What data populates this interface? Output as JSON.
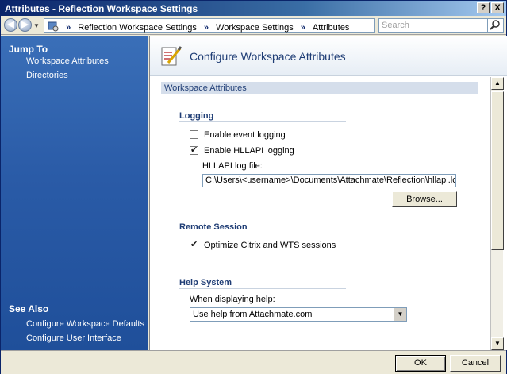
{
  "window": {
    "title": "Attributes - Reflection Workspace Settings",
    "help_button": "?",
    "close_button": "X"
  },
  "addressbar": {
    "crumbs": [
      "Reflection Workspace Settings",
      "Workspace Settings",
      "Attributes"
    ],
    "search_placeholder": "Search"
  },
  "leftpane": {
    "jump_to_header": "Jump To",
    "jump_links": [
      "Workspace Attributes",
      "Directories"
    ],
    "see_also_header": "See Also",
    "see_also_links": [
      "Configure Workspace Defaults",
      "Configure User Interface"
    ]
  },
  "main": {
    "title": "Configure Workspace Attributes",
    "section_title": "Workspace Attributes",
    "logging": {
      "header": "Logging",
      "event_logging_label": "Enable event logging",
      "event_logging_checked": false,
      "hllapi_logging_label": "Enable HLLAPI logging",
      "hllapi_logging_checked": true,
      "log_file_label": "HLLAPI log file:",
      "log_file_value": "C:\\Users\\<username>\\Documents\\Attachmate\\Reflection\\hllapi.log",
      "browse_label": "Browse..."
    },
    "remote_session": {
      "header": "Remote Session",
      "optimize_label": "Optimize Citrix and WTS sessions",
      "optimize_checked": true
    },
    "help_system": {
      "header": "Help System",
      "when_label": "When displaying help:",
      "selected_option": "Use help from Attachmate.com"
    }
  },
  "footer": {
    "ok_label": "OK",
    "cancel_label": "Cancel"
  }
}
